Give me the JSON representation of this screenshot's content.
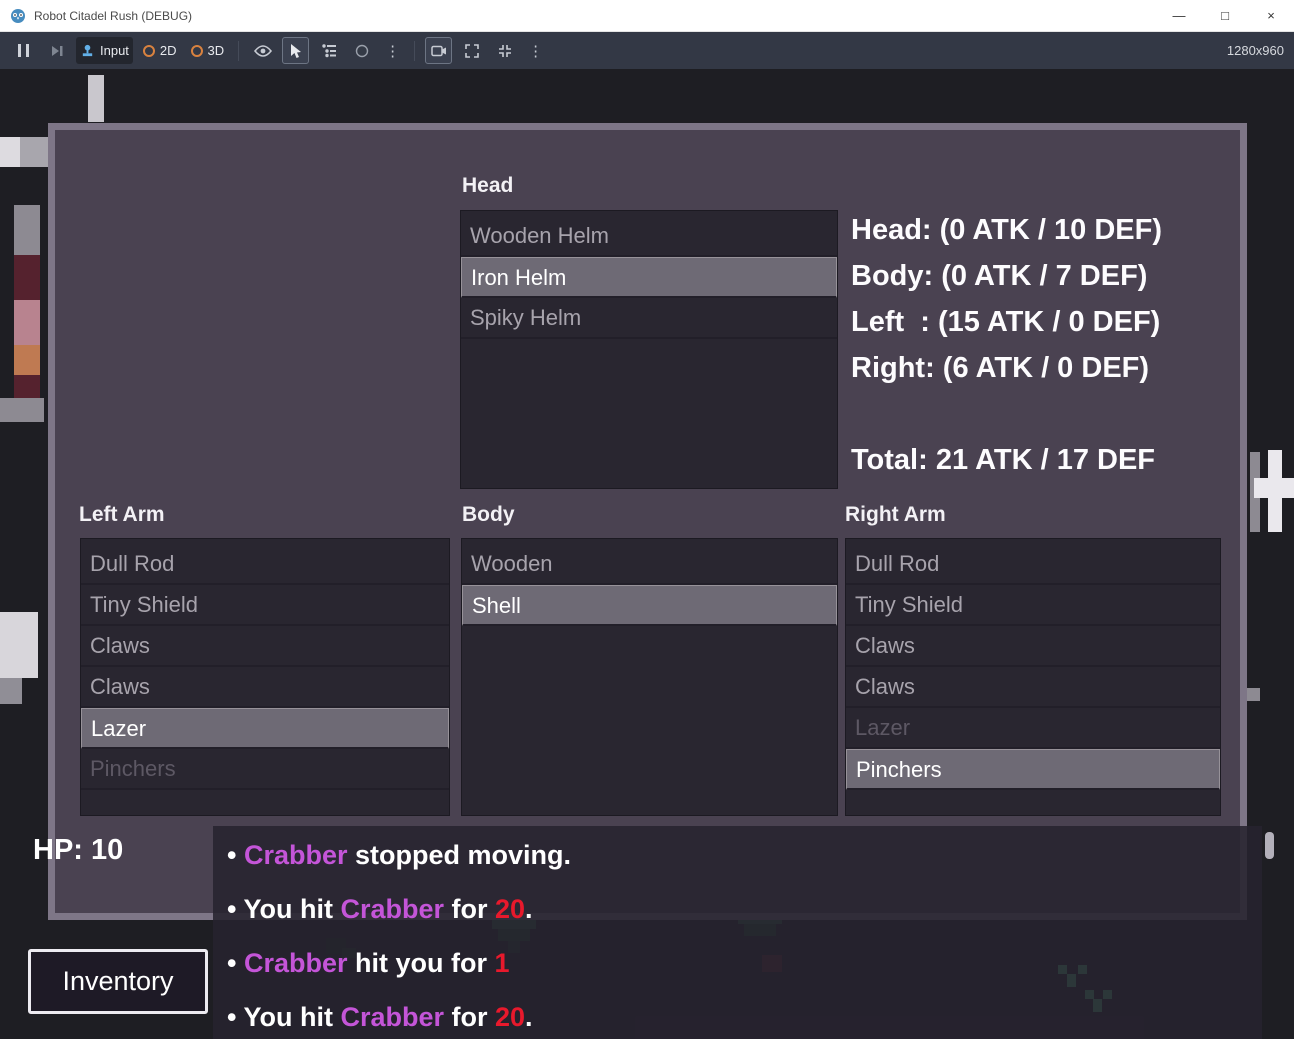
{
  "window": {
    "title": "Robot Citadel Rush (DEBUG)",
    "controls": {
      "minimize": "—",
      "maximize": "□",
      "close": "×"
    }
  },
  "toolbar": {
    "input_label": "Input",
    "view_2d": "2D",
    "view_3d": "3D",
    "dots": "⋮",
    "resolution": "1280x960"
  },
  "equipment": {
    "head": {
      "label": "Head",
      "items": [
        {
          "name": "Wooden Helm",
          "state": "normal"
        },
        {
          "name": "Iron Helm",
          "state": "selected"
        },
        {
          "name": "Spiky Helm",
          "state": "normal"
        }
      ]
    },
    "left_arm": {
      "label": "Left Arm",
      "items": [
        {
          "name": "Dull Rod",
          "state": "normal"
        },
        {
          "name": "Tiny Shield",
          "state": "normal"
        },
        {
          "name": "Claws",
          "state": "normal"
        },
        {
          "name": "Claws",
          "state": "normal"
        },
        {
          "name": "Lazer",
          "state": "selected"
        },
        {
          "name": "Pinchers",
          "state": "disabled"
        }
      ]
    },
    "body": {
      "label": "Body",
      "items": [
        {
          "name": "Wooden",
          "state": "normal"
        },
        {
          "name": "Shell",
          "state": "selected"
        }
      ]
    },
    "right_arm": {
      "label": "Right Arm",
      "items": [
        {
          "name": "Dull Rod",
          "state": "normal"
        },
        {
          "name": "Tiny Shield",
          "state": "normal"
        },
        {
          "name": "Claws",
          "state": "normal"
        },
        {
          "name": "Claws",
          "state": "normal"
        },
        {
          "name": "Lazer",
          "state": "disabled"
        },
        {
          "name": "Pinchers",
          "state": "selected"
        }
      ]
    },
    "stats": {
      "head": "Head: (0 ATK / 10 DEF)",
      "body": "Body: (0 ATK / 7 DEF)",
      "left": "Left  : (15 ATK / 0 DEF)",
      "right": "Right: (6 ATK / 0 DEF)",
      "total": "Total: 21 ATK / 17 DEF"
    }
  },
  "hud": {
    "hp": "HP: 10",
    "inventory_button": "Inventory"
  },
  "log": {
    "messages": [
      [
        {
          "text": "• ",
          "color": "#ffffff"
        },
        {
          "text": "Crabber",
          "color": "#c455d8"
        },
        {
          "text": " stopped moving.",
          "color": "#ffffff"
        }
      ],
      [
        {
          "text": "• You hit ",
          "color": "#ffffff"
        },
        {
          "text": "Crabber",
          "color": "#c455d8"
        },
        {
          "text": " for ",
          "color": "#ffffff"
        },
        {
          "text": "20",
          "color": "#e8192c"
        },
        {
          "text": ".",
          "color": "#ffffff"
        }
      ],
      [
        {
          "text": "• ",
          "color": "#ffffff"
        },
        {
          "text": "Crabber",
          "color": "#c455d8"
        },
        {
          "text": " hit you for ",
          "color": "#ffffff"
        },
        {
          "text": "1",
          "color": "#e8192c"
        }
      ],
      [
        {
          "text": "• You hit ",
          "color": "#ffffff"
        },
        {
          "text": "Crabber",
          "color": "#c455d8"
        },
        {
          "text": " for ",
          "color": "#ffffff"
        },
        {
          "text": "20",
          "color": "#e8192c"
        },
        {
          "text": ".",
          "color": "#ffffff"
        }
      ]
    ]
  },
  "colors": {
    "enemy_name": "#c455d8",
    "damage_number": "#e8192c",
    "selection_background": "#6e6a75",
    "panel_background": "#4a4251",
    "panel_border": "#7e7687"
  }
}
